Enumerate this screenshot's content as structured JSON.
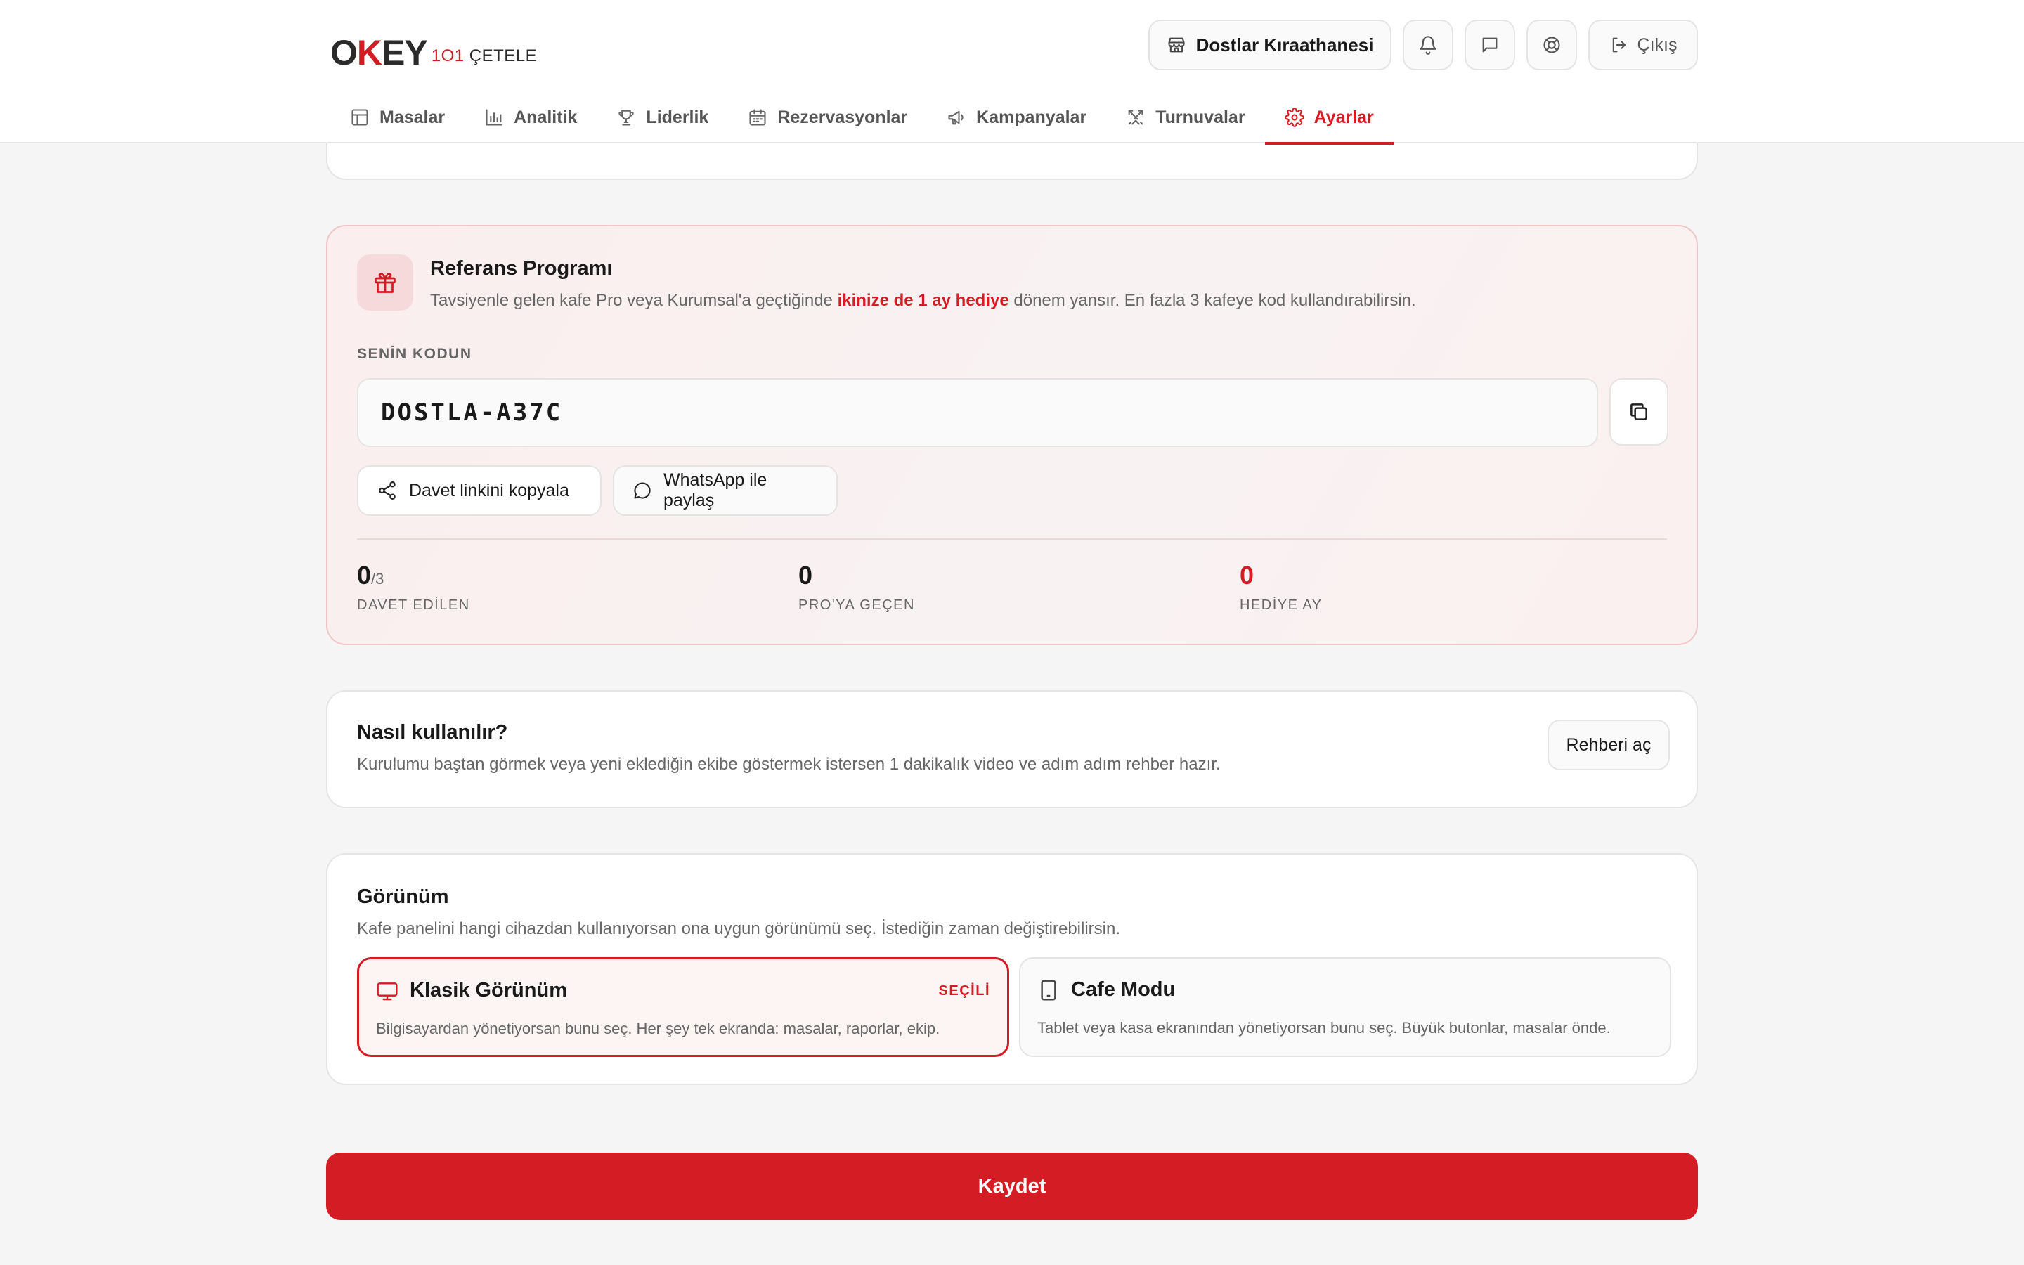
{
  "brand": {
    "logo_main_prefix": "O",
    "logo_main_k": "K",
    "logo_main_suffix": "EY",
    "logo_sub_num": "1O1",
    "logo_sub_text": "ÇETELE",
    "accent_color": "#d41c24"
  },
  "header": {
    "cafe_name": "Dostlar Kıraathanesi",
    "logout_label": "Çıkış",
    "icons": [
      "store-icon",
      "bell-icon",
      "message-icon",
      "lifebuoy-icon",
      "logout-icon"
    ]
  },
  "tabs": [
    {
      "label": "Masalar",
      "icon": "table-icon"
    },
    {
      "label": "Analitik",
      "icon": "chart-icon"
    },
    {
      "label": "Liderlik",
      "icon": "trophy-icon"
    },
    {
      "label": "Rezervasyonlar",
      "icon": "calendar-icon"
    },
    {
      "label": "Kampanyalar",
      "icon": "megaphone-icon"
    },
    {
      "label": "Turnuvalar",
      "icon": "swords-icon"
    },
    {
      "label": "Ayarlar",
      "icon": "gear-icon",
      "active": true
    }
  ],
  "referral": {
    "title": "Referans Programı",
    "desc_prefix": "Tavsiyenle gelen kafe Pro veya Kurumsal'a geçtiğinde ",
    "desc_highlight": "ikinize de 1 ay hediye",
    "desc_suffix": " dönem yansır. En fazla 3 kafeye kod kullandırabilirsin.",
    "code_label": "SENİN KODUN",
    "code_value": "DOSTLA-A37C",
    "invite_button": "Davet linkini kopyala",
    "whatsapp_button": "WhatsApp ile paylaş",
    "stats": [
      {
        "value": "0",
        "of": "/3",
        "label": "DAVET EDİLEN"
      },
      {
        "value": "0",
        "of": "",
        "label": "PRO'YA GEÇEN"
      },
      {
        "value": "0",
        "of": "",
        "label": "HEDİYE AY"
      }
    ]
  },
  "howto": {
    "title": "Nasıl kullanılır?",
    "desc": "Kurulumu baştan görmek veya yeni eklediğin ekibe göstermek istersen 1 dakikalık video ve adım adım rehber hazır.",
    "button": "Rehberi aç"
  },
  "view": {
    "title": "Görünüm",
    "desc": "Kafe panelini hangi cihazdan kullanıyorsan ona uygun görünümü seç. İstediğin zaman değiştirebilirsin.",
    "options": [
      {
        "title": "Klasik Görünüm",
        "desc": "Bilgisayardan yönetiyorsan bunu seç. Her şey tek ekranda: masalar, raporlar, ekip.",
        "badge": "SEÇİLİ",
        "selected": true,
        "icon": "monitor-icon"
      },
      {
        "title": "Cafe Modu",
        "desc": "Tablet veya kasa ekranından yönetiyorsan bunu seç. Büyük butonlar, masalar önde.",
        "badge": "",
        "selected": false,
        "icon": "tablet-icon"
      }
    ]
  },
  "save_button": "Kaydet"
}
